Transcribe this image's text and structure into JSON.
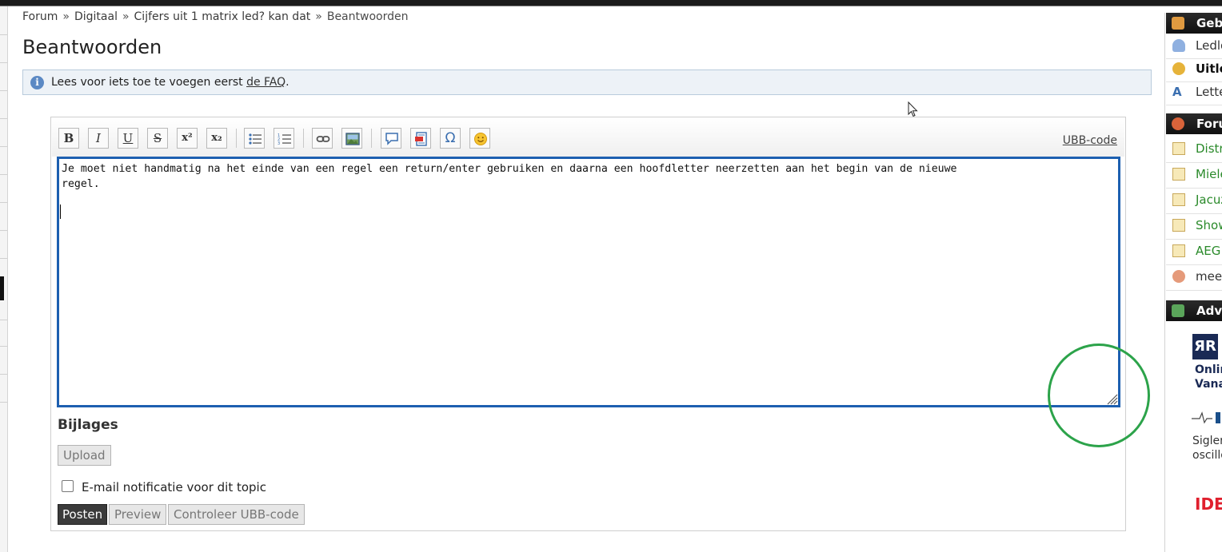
{
  "breadcrumb": {
    "items": [
      "Forum",
      "Digitaal",
      "Cijfers uit 1 matrix led? kan dat",
      "Beantwoorden"
    ],
    "separator": "»"
  },
  "page": {
    "title": "Beantwoorden"
  },
  "info": {
    "text_before": "Lees voor iets toe te voegen eerst ",
    "link": "de FAQ",
    "text_after": "."
  },
  "toolbar": {
    "buttons": [
      {
        "name": "bold",
        "glyph": "B"
      },
      {
        "name": "italic",
        "glyph": "I"
      },
      {
        "name": "underline",
        "glyph": "U"
      },
      {
        "name": "strikethrough",
        "glyph": "S"
      },
      {
        "name": "superscript",
        "glyph": "x²"
      },
      {
        "name": "subscript",
        "glyph": "x₂"
      },
      {
        "name": "bullet-list-icon"
      },
      {
        "name": "numbered-list-icon"
      },
      {
        "name": "link-icon"
      },
      {
        "name": "image-icon"
      },
      {
        "name": "quote-icon"
      },
      {
        "name": "code-icon"
      },
      {
        "name": "special-char",
        "glyph": "Ω"
      },
      {
        "name": "smiley-icon"
      }
    ],
    "ubb_link": "UBB-code"
  },
  "editor": {
    "text": "Je moet niet handmatig na het einde van een regel een return/enter gebruiken en daarna een hoofdletter neerzetten aan het begin van de nieuwe\nregel."
  },
  "attachments": {
    "title": "Bijlages",
    "upload_label": "Upload"
  },
  "notify": {
    "label": "E-mail notificatie voor dit topic",
    "checked": false
  },
  "actions": {
    "post": "Posten",
    "preview": "Preview",
    "check": "Controleer UBB-code"
  },
  "sidebar": {
    "user_header": "Gebr",
    "user_items": [
      "Ledlo",
      "Uitlo",
      "Lette"
    ],
    "forum_header": "Forum",
    "forum_items": [
      "Distri",
      "Miele",
      "Jacuz",
      "Show",
      "AEG V",
      "meer"
    ],
    "ads_header": "Adve",
    "ad1": {
      "logo": "ЯR",
      "line1": "Onlin",
      "line2": "Vana"
    },
    "ad2": {
      "line1": "Sigler",
      "line2": "oscillo"
    },
    "ad3": {
      "text": "IDE"
    }
  },
  "colors": {
    "editor_border": "#1d5fb0",
    "annotation_circle": "#2ca34a",
    "forum_link": "#2a8a2a"
  }
}
